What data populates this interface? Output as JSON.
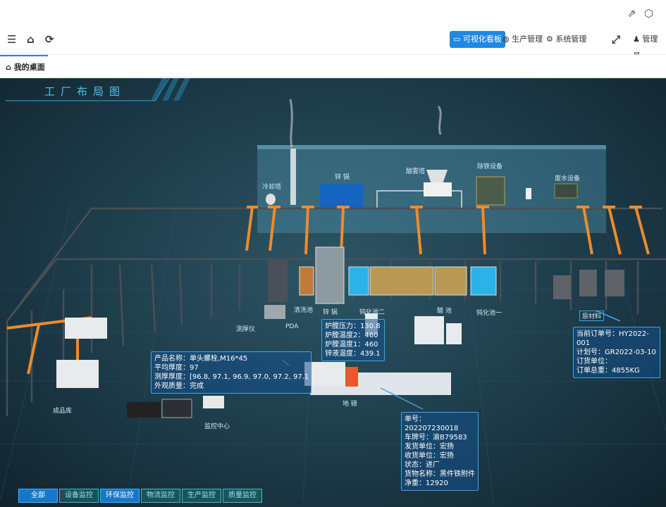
{
  "topstrip": {
    "icons": [
      "share-icon",
      "cube-icon"
    ]
  },
  "navbar": {
    "left_icons": [
      "menu-indent-icon",
      "home-icon",
      "refresh-icon"
    ],
    "items": [
      {
        "label": "可视化看板",
        "icon": "monitor-icon",
        "active": true
      },
      {
        "label": "生产管理",
        "icon": "dashboard-icon",
        "active": false
      },
      {
        "label": "系统管理",
        "icon": "gear-icon",
        "active": false
      }
    ],
    "user": "管理员"
  },
  "tabs": [
    {
      "label": "我的桌面",
      "icon": "home-icon"
    }
  ],
  "map": {
    "title": "工厂布局图",
    "labels": {
      "cooling_tower": "冷却塔",
      "zinc_pot": "锌 锅",
      "acid_mist_tower": "酸雾塔",
      "iron_removal": "除铁设备",
      "wastewater": "废水设备",
      "cleaning_pool": "清洗池",
      "zinc_pot2": "锌 锅",
      "passivation1": "钝化池二",
      "acid_pool": "酸 池",
      "passivation2": "钝化池一",
      "thickness_gauge": "测厚仪",
      "pda": "PDA",
      "raw_material": "原材料",
      "finished_goods": "成品库",
      "monitor_center": "监控中心",
      "weighbridge": "地 磅"
    },
    "zinc_panel": {
      "lines": [
        "炉膛压力：130.8",
        "炉膛温度2：460",
        "炉膛温度1：460",
        "锌液温度：439.1"
      ]
    },
    "product_panel": {
      "lines": [
        "产品名称：单头螺栓,M16*45",
        "平均厚度：97",
        "测厚厚度：[96.8, 97.1, 96.9, 97.0, 97.2, 97.1, 96.9]",
        "外观质量：完成"
      ]
    },
    "order_panel": {
      "lines": [
        "当前订单号：HY2022-001",
        "计划号：GR2022-03-10",
        "订货单位：",
        "订单总重：4855KG"
      ]
    },
    "truck_panel": {
      "lines": [
        "单号：202207230018",
        "车牌号：渝B79583",
        "发货单位：宏扬",
        "收货单位：宏扬",
        "状态：进厂",
        "货物名称：黑件铁附件",
        "净重：12920"
      ]
    }
  },
  "bottom_buttons": [
    {
      "label": "全部",
      "active": true
    },
    {
      "label": "设备监控",
      "active": false
    },
    {
      "label": "环保监控",
      "active": false
    },
    {
      "label": "物流监控",
      "active": false
    },
    {
      "label": "生产监控",
      "active": false
    },
    {
      "label": "质量监控",
      "active": false
    }
  ]
}
